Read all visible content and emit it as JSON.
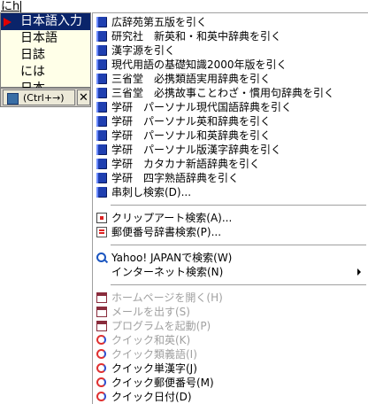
{
  "composition": {
    "text": "にh"
  },
  "candidates": [
    {
      "text": "日本語入力",
      "selected": true
    },
    {
      "text": "日本語",
      "selected": false
    },
    {
      "text": "日誌",
      "selected": false
    },
    {
      "text": "には",
      "selected": false
    },
    {
      "text": "日本",
      "selected": false
    }
  ],
  "candidate_bar": {
    "ctrl_label": "(Ctrl+→)",
    "close_label": "✕"
  },
  "menu": {
    "dictionary_items": [
      {
        "label": "広辞苑第五版を引く",
        "icon": "book-icon"
      },
      {
        "label": "研究社　新英和・和英中辞典を引く",
        "icon": "book-icon"
      },
      {
        "label": "漢字源を引く",
        "icon": "book-icon"
      },
      {
        "label": "現代用語の基礎知識2000年版を引く",
        "icon": "book-icon"
      },
      {
        "label": "三省堂　必携類語実用辞典を引く",
        "icon": "book-icon"
      },
      {
        "label": "三省堂　必携故事ことわざ・慣用句辞典を引く",
        "icon": "book-icon"
      },
      {
        "label": "学研　パーソナル現代国語辞典を引く",
        "icon": "book-icon"
      },
      {
        "label": "学研　パーソナル英和辞典を引く",
        "icon": "book-icon"
      },
      {
        "label": "学研　パーソナル和英辞典を引く",
        "icon": "book-icon"
      },
      {
        "label": "学研　パーソナル版漢字辞典を引く",
        "icon": "book-icon"
      },
      {
        "label": "学研　カタカナ新語辞典を引く",
        "icon": "book-icon"
      },
      {
        "label": "学研　四字熟語辞典を引く",
        "icon": "book-icon"
      },
      {
        "label": "串刺し検索(D)...",
        "icon": "book-icon"
      }
    ],
    "search_items": [
      {
        "label": "クリップアート検索(A)...",
        "icon": "clipart-icon"
      },
      {
        "label": "郵便番号辞書検索(P)...",
        "icon": "postal-icon"
      }
    ],
    "web_items": [
      {
        "label": "Yahoo! JAPANで検索(W)",
        "icon": "web-search-icon",
        "submenu": false
      },
      {
        "label": "インターネット検索(N)",
        "icon": "",
        "submenu": true
      }
    ],
    "quick_items": [
      {
        "label": "ホームページを開く(H)",
        "icon": "window-icon",
        "disabled": true
      },
      {
        "label": "メールを出す(S)",
        "icon": "window-icon",
        "disabled": true
      },
      {
        "label": "プログラムを起動(P)",
        "icon": "window-icon",
        "disabled": true
      },
      {
        "label": "クイック和英(K)",
        "icon": "quick-icon",
        "disabled": true
      },
      {
        "label": "クイック類義語(I)",
        "icon": "quick-icon",
        "disabled": true
      },
      {
        "label": "クイック単漢字(J)",
        "icon": "quick-icon",
        "disabled": false
      },
      {
        "label": "クイック郵便番号(M)",
        "icon": "quick-icon",
        "disabled": false
      },
      {
        "label": "クイック日付(D)",
        "icon": "quick-icon",
        "disabled": false
      }
    ]
  }
}
